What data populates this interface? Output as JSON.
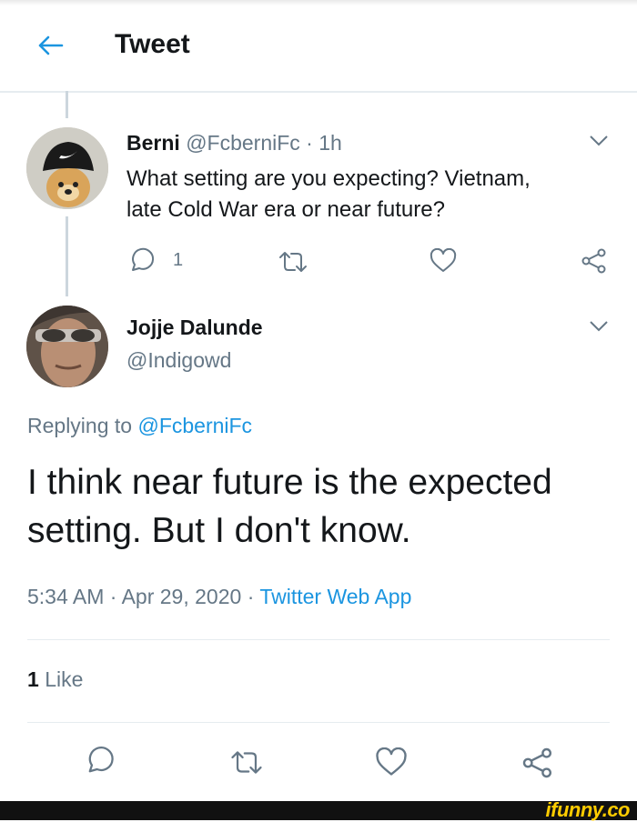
{
  "header": {
    "title": "Tweet"
  },
  "reply_tweet": {
    "author_name": "Berni",
    "author_handle": "@FcberniFc",
    "separator": "·",
    "time": "1h",
    "text_line1": "What setting are you expecting? Vietnam,",
    "text_line2": "late Cold War era or near future?",
    "reply_count": "1"
  },
  "main_tweet": {
    "author_name": "Jojje Dalunde",
    "author_handle": "@Indigowd",
    "replying_prefix": "Replying to",
    "replying_handle": "@FcberniFc",
    "text_line1": "I think near future is the expected",
    "text_line2": "setting. But I don't know.",
    "time": "5:34 AM",
    "sep1": "·",
    "date": "Apr 29, 2020",
    "sep2": "·",
    "source": "Twitter Web App",
    "likes_count": "1",
    "likes_label": "Like"
  },
  "watermark": {
    "text": "ifunny.co"
  },
  "colors": {
    "accent": "#1b95e0",
    "muted": "#657786",
    "icon": "#657786",
    "text": "#14171a"
  }
}
